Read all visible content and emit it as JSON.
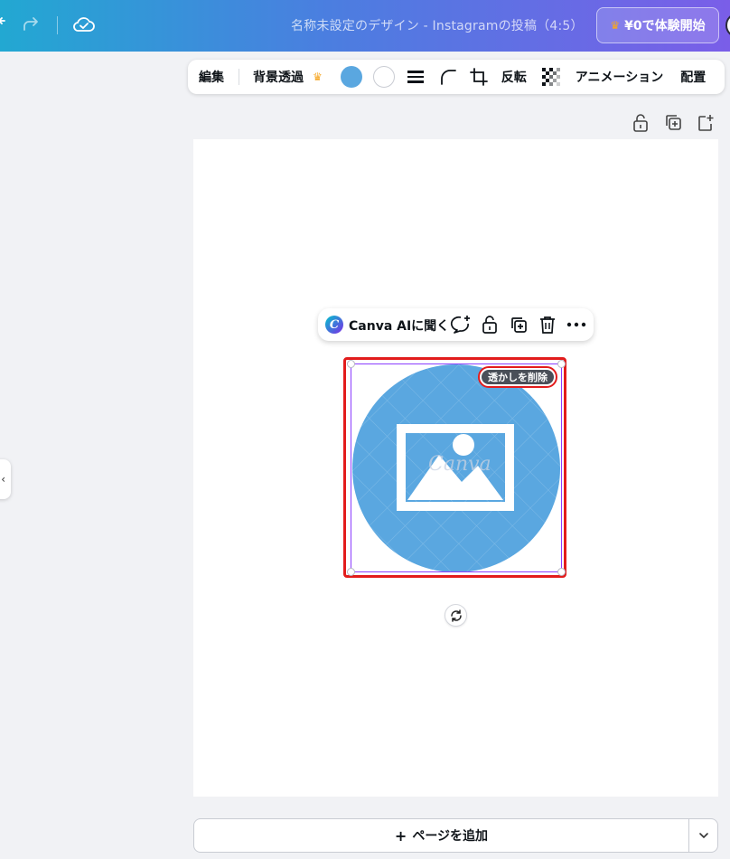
{
  "header": {
    "doc_title": "名称未設定のデザイン - Instagramの投稿（4:5）",
    "trial_button": {
      "crown": "♛",
      "label": "¥0で体験開始"
    }
  },
  "toolbar": {
    "edit_label": "編集",
    "bg_remove_label": "背景透過",
    "crown": "♛",
    "fill_color": "#5aa7e0",
    "secondary_color": "#ffffff",
    "flip_label": "反転",
    "animation_label": "アニメーション",
    "position_label": "配置"
  },
  "context_menu": {
    "ai_logo_letter": "C",
    "ai_label": "Canva AIに聞く"
  },
  "image": {
    "circle_color": "#5aa7e0",
    "watermark_text": "Canva",
    "remove_watermark_label": "透かしを削除"
  },
  "selection": {
    "outline_color": "#e21c1c"
  },
  "footer": {
    "add_page_label": "ページを追加",
    "add_page_plus": "+"
  }
}
